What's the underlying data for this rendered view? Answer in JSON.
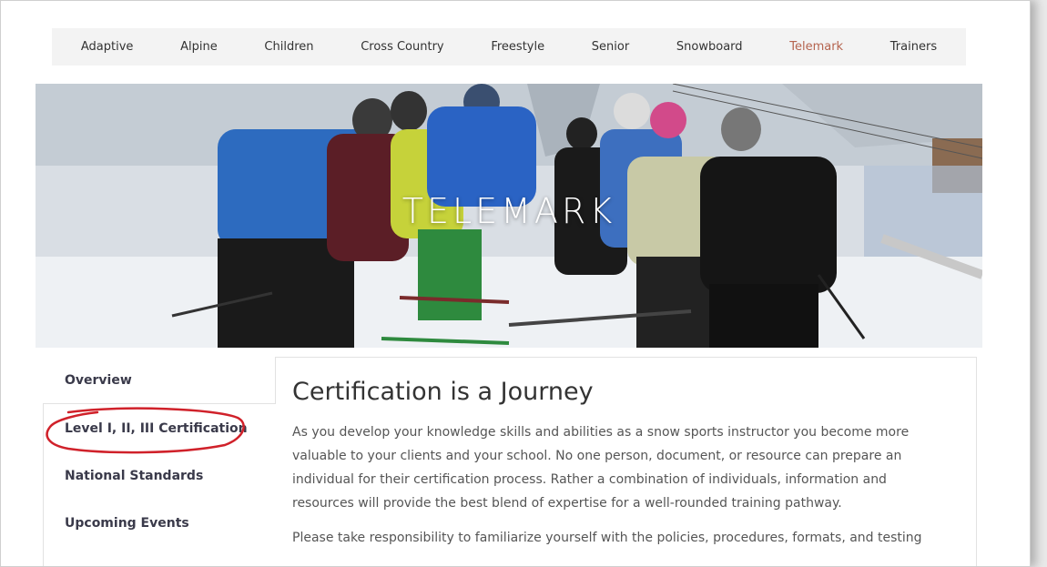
{
  "nav": {
    "items": [
      {
        "label": "Adaptive"
      },
      {
        "label": "Alpine"
      },
      {
        "label": "Children"
      },
      {
        "label": "Cross Country"
      },
      {
        "label": "Freestyle"
      },
      {
        "label": "Senior"
      },
      {
        "label": "Snowboard"
      },
      {
        "label": "Telemark",
        "active": true
      },
      {
        "label": "Trainers"
      }
    ],
    "active_color": "#b5644f"
  },
  "hero": {
    "title": "TELEMARK"
  },
  "sidebar": {
    "items": [
      {
        "label": "Overview"
      },
      {
        "label": "Level I, II, III Certification"
      },
      {
        "label": "National Standards"
      },
      {
        "label": "Upcoming Events"
      }
    ]
  },
  "main": {
    "heading": "Certification is a Journey",
    "paragraphs": [
      "As you develop your knowledge skills and abilities as a snow sports instructor you become more valuable to your clients and your school.  No one person, document, or resource can prepare an individual for their certification process. Rather a combination of individuals, information and resources will provide the best blend of expertise for a well-rounded training pathway.",
      "Please take responsibility to familiarize yourself with the policies, procedures, formats, and testing"
    ]
  },
  "annotation_color": "#d0212a"
}
